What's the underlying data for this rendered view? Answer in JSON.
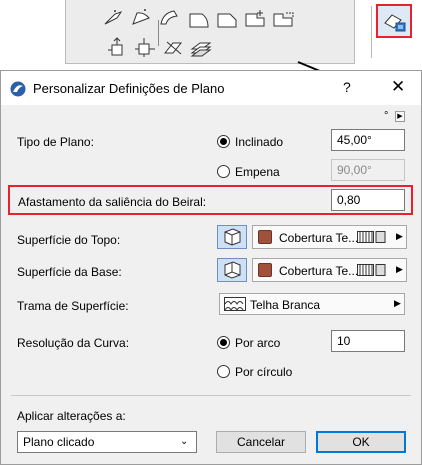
{
  "dialog": {
    "title": "Personalizar Definições de Plano",
    "help_label": "?",
    "close_label": "✕",
    "degree_unit": "°",
    "arrow_label": "▶"
  },
  "form": {
    "tipo_plano": {
      "label": "Tipo de Plano:",
      "options": [
        {
          "label": "Inclinado",
          "selected": true,
          "value": "45,00°"
        },
        {
          "label": "Empena",
          "selected": false,
          "value": "90,00°"
        }
      ]
    },
    "afastamento": {
      "label": "Afastamento da saliência do Beiral:",
      "value": "0,80"
    },
    "superficie_topo": {
      "label": "Superfície do Topo:",
      "material": "Cobertura Te..."
    },
    "superficie_base": {
      "label": "Superfície da Base:",
      "material": "Cobertura Te..."
    },
    "trama": {
      "label": "Trama de Superfície:",
      "value": "Telha Branca"
    },
    "resolucao": {
      "label": "Resolução da Curva:",
      "options": [
        {
          "label": "Por arco",
          "selected": true,
          "value": "10"
        },
        {
          "label": "Por círculo",
          "selected": false
        }
      ]
    }
  },
  "footer": {
    "apply_label": "Aplicar alterações a:",
    "apply_value": "Plano clicado",
    "cancel_label": "Cancelar",
    "ok_label": "OK"
  },
  "colors": {
    "highlight": "#e8212a",
    "material_swatch": "#a0523d",
    "accent": "#0078d7"
  }
}
